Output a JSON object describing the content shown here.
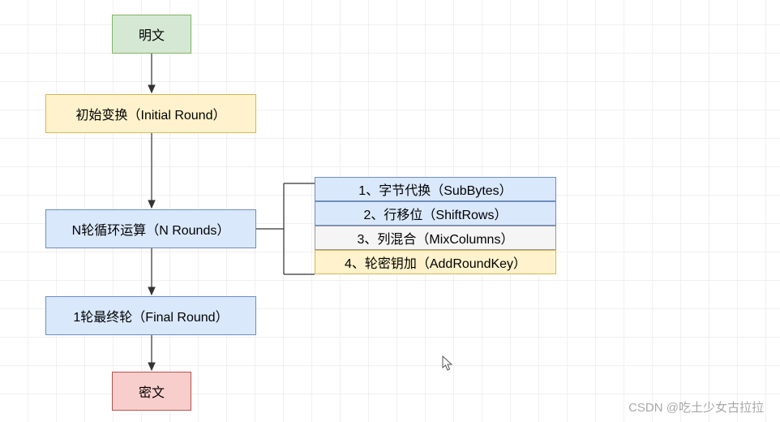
{
  "nodes": {
    "plaintext": "明文",
    "initial_round": "初始变换（Initial Round）",
    "n_rounds": "N轮循环运算（N Rounds）",
    "final_round": "1轮最终轮（Final Round）",
    "ciphertext": "密文"
  },
  "steps": {
    "sub_bytes": "1、字节代换（SubBytes）",
    "shift_rows": "2、行移位（ShiftRows）",
    "mix_columns": "3、列混合（MixColumns）",
    "add_round_key": "4、轮密钥加（AddRoundKey）"
  },
  "watermark": "CSDN @吃土少女古拉拉",
  "colors": {
    "green_fill": "#d5e8d4",
    "green_border": "#82b366",
    "yellow_fill": "#fff2cc",
    "yellow_border": "#d6b656",
    "blue_fill": "#dae8fc",
    "blue_border": "#6c8ebf",
    "grey_fill": "#f5f5f5",
    "grey_border": "#999999",
    "red_fill": "#f8cecc",
    "red_border": "#b85450"
  }
}
